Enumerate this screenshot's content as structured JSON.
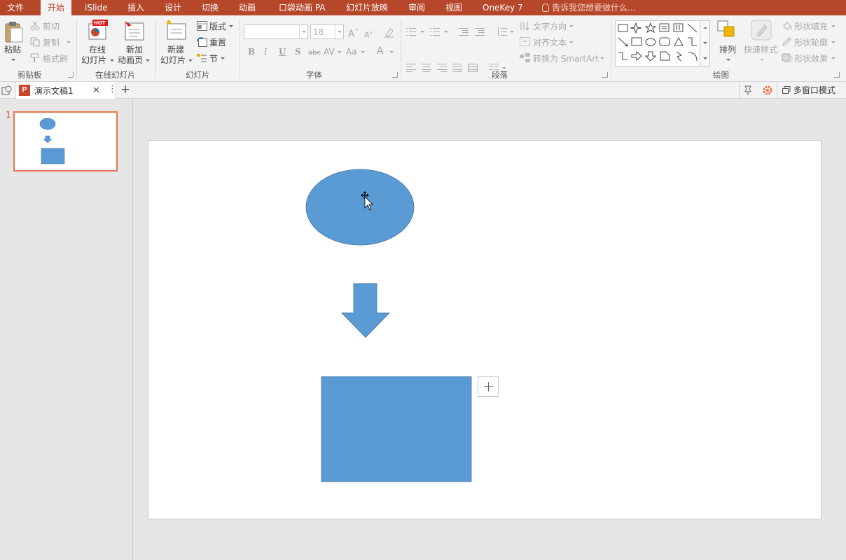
{
  "menu": {
    "items": [
      "文件",
      "开始",
      "iSlide",
      "插入",
      "设计",
      "切换",
      "动画",
      "口袋动画 PA",
      "幻灯片放映",
      "审阅",
      "视图",
      "OneKey 7"
    ],
    "active": "开始",
    "tell_me": "告诉我您想要做什么..."
  },
  "ribbon": {
    "clipboard": {
      "paste": "粘贴",
      "cut": "剪切",
      "copy": "复制",
      "format_painter": "格式刷",
      "label": "剪贴板"
    },
    "online": {
      "hot_badge": "HOT",
      "online_slides_line1": "在线",
      "online_slides_line2": "幻灯片",
      "new_anim_line1": "新加",
      "new_anim_line2": "动画页",
      "label": "在线幻灯片"
    },
    "slides": {
      "new_slide_line1": "新建",
      "new_slide_line2": "幻灯片",
      "layout": "版式",
      "reset": "重置",
      "section": "节",
      "label": "幻灯片"
    },
    "font": {
      "font_name": "",
      "font_size": "18",
      "bold": "B",
      "italic": "I",
      "underline": "U",
      "shadow": "S",
      "strike": "abc",
      "spacing": "AV",
      "case": "Aa",
      "color": "A",
      "label": "字体"
    },
    "paragraph": {
      "text_direction": "文字方向",
      "align_text": "对齐文本",
      "convert_smartart": "转换为 SmartArt",
      "label": "段落"
    },
    "drawing": {
      "arrange": "排列",
      "quick_styles": "快速样式",
      "shape_fill": "形状填充",
      "shape_outline": "形状轮廓",
      "shape_effects": "形状效果",
      "label": "绘图"
    }
  },
  "tabbar": {
    "doc_icon": "P",
    "doc_name": "演示文稿1",
    "multi_window": "多窗口模式"
  },
  "thumbnails": [
    {
      "number": "1"
    }
  ],
  "colors": {
    "accent": "#b7472a",
    "shape_fill": "#5b9bd5",
    "shape_stroke": "#41719c",
    "thumb_border": "#e8754f"
  },
  "slide": {
    "shapes": [
      "ellipse",
      "down-arrow",
      "rectangle"
    ]
  }
}
